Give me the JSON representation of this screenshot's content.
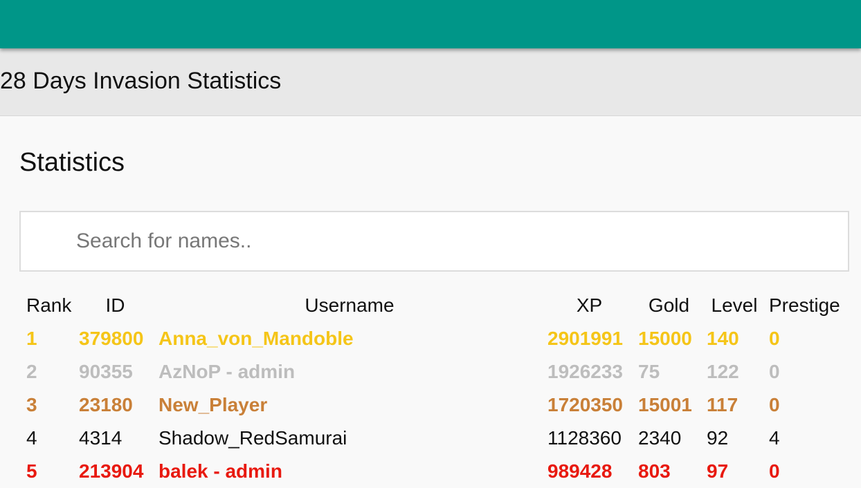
{
  "header": {
    "title": "28 Days Invasion Statistics"
  },
  "main": {
    "section_title": "Statistics",
    "search": {
      "placeholder": "Search for names..",
      "value": ""
    },
    "table": {
      "columns": [
        "Rank",
        "ID",
        "Username",
        "XP",
        "Gold",
        "Level",
        "Prestige"
      ],
      "rows": [
        {
          "rank": "1",
          "id": "379800",
          "username": "Anna_von_Mandoble",
          "xp": "2901991",
          "gold": "15000",
          "level": "140",
          "prestige": "0",
          "style": "gold"
        },
        {
          "rank": "2",
          "id": "90355",
          "username": "AzNoP - admin",
          "xp": "1926233",
          "gold": "75",
          "level": "122",
          "prestige": "0",
          "style": "silver"
        },
        {
          "rank": "3",
          "id": "23180",
          "username": "New_Player",
          "xp": "1720350",
          "gold": "15001",
          "level": "117",
          "prestige": "0",
          "style": "bronze"
        },
        {
          "rank": "4",
          "id": "4314",
          "username": "Shadow_RedSamurai",
          "xp": "1128360",
          "gold": "2340",
          "level": "92",
          "prestige": "4",
          "style": "normal"
        },
        {
          "rank": "5",
          "id": "213904",
          "username": "balek - admin",
          "xp": "989428",
          "gold": "803",
          "level": "97",
          "prestige": "0",
          "style": "admin"
        }
      ]
    }
  },
  "colors": {
    "topbar": "#009688",
    "gold": "#f5c518",
    "silver": "#bdbdbd",
    "bronze": "#c98038",
    "admin": "#e8190f"
  }
}
